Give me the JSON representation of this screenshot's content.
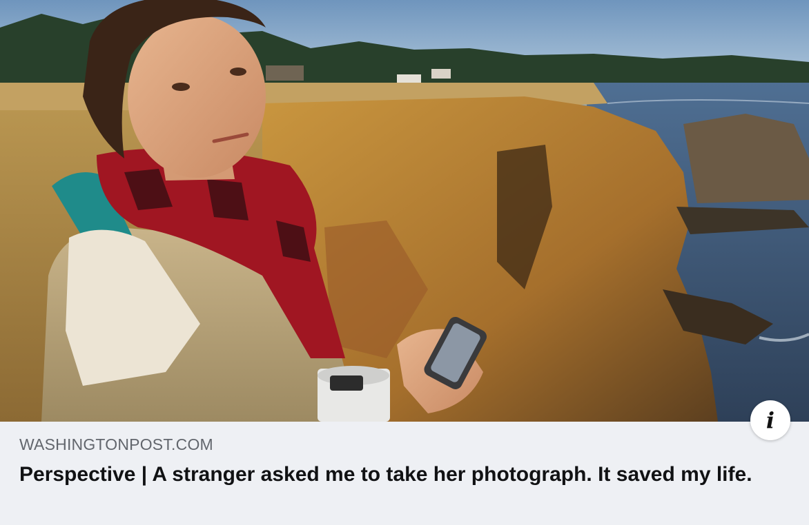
{
  "link_preview": {
    "image_alt": "photo",
    "domain": "WASHINGTONPOST.COM",
    "headline": "Perspective | A stranger asked me to take her photograph. It saved my life.",
    "info_icon": "info-icon",
    "info_glyph": "i"
  },
  "colors": {
    "caption_background": "#eef0f4",
    "domain_text": "#62666d",
    "headline_text": "#111214",
    "info_button_bg": "#ffffff"
  }
}
